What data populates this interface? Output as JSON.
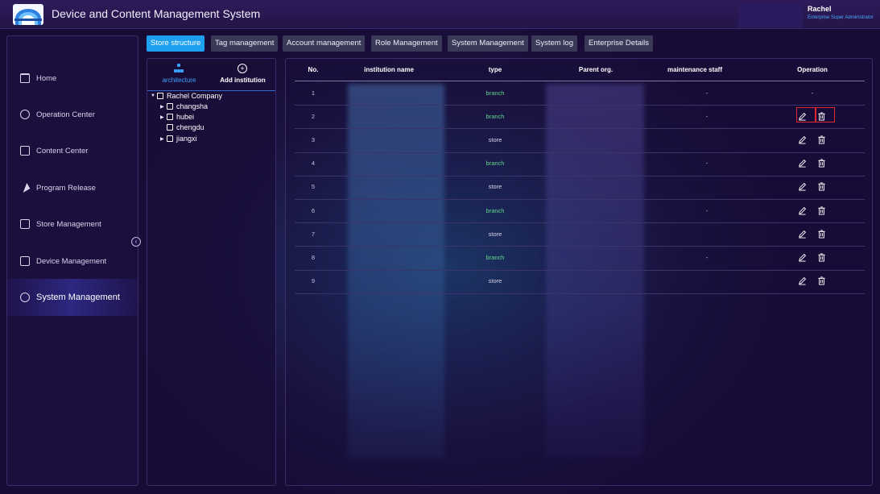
{
  "header": {
    "title": "Device and Content Management System",
    "user_name": "Rachel",
    "user_role": "Enterprise Super Administrator"
  },
  "sidebar": {
    "items": [
      {
        "label": "Home",
        "icon": "home-icon"
      },
      {
        "label": "Operation Center",
        "icon": "operation-icon"
      },
      {
        "label": "Content Center",
        "icon": "content-icon"
      },
      {
        "label": "Program Release",
        "icon": "send-icon"
      },
      {
        "label": "Store Management",
        "icon": "store-icon"
      },
      {
        "label": "Device Management",
        "icon": "device-icon"
      },
      {
        "label": "System Management",
        "icon": "gear-icon",
        "active": true
      }
    ]
  },
  "tabs": [
    {
      "label": "Store structure",
      "active": true
    },
    {
      "label": "Tag management"
    },
    {
      "label": "Account management"
    },
    {
      "label": "Role Management"
    },
    {
      "label": "System Management"
    },
    {
      "label": "System log"
    },
    {
      "label": "Enterprise Details"
    }
  ],
  "tree": {
    "tab_architecture": "architecture",
    "tab_add": "Add institution",
    "nodes": [
      {
        "label": "Rachel Company",
        "expanded": true
      },
      {
        "label": "changsha"
      },
      {
        "label": "hubei"
      },
      {
        "label": "chengdu"
      },
      {
        "label": "jiangxi"
      }
    ]
  },
  "table": {
    "columns": [
      "No.",
      "institution name",
      "type",
      "Parent org.",
      "maintenance staff",
      "Operation"
    ],
    "rows": [
      {
        "no": "1",
        "type": "branch",
        "maint": "-",
        "op": "-"
      },
      {
        "no": "2",
        "type": "branch",
        "maint": "-",
        "op": "edit-delete"
      },
      {
        "no": "3",
        "type": "store",
        "maint": "",
        "op": "edit-delete"
      },
      {
        "no": "4",
        "type": "branch",
        "maint": "-",
        "op": "edit-delete"
      },
      {
        "no": "5",
        "type": "store",
        "maint": "",
        "op": "edit-delete"
      },
      {
        "no": "6",
        "type": "branch",
        "maint": "-",
        "op": "edit-delete"
      },
      {
        "no": "7",
        "type": "store",
        "maint": "",
        "op": "edit-delete"
      },
      {
        "no": "8",
        "type": "branch",
        "maint": "-",
        "op": "edit-delete"
      },
      {
        "no": "9",
        "type": "store",
        "maint": "",
        "op": "edit-delete"
      }
    ]
  },
  "colors": {
    "accent": "#1ea0f0",
    "branch": "#5ed68b",
    "highlight": "#e0262e"
  }
}
